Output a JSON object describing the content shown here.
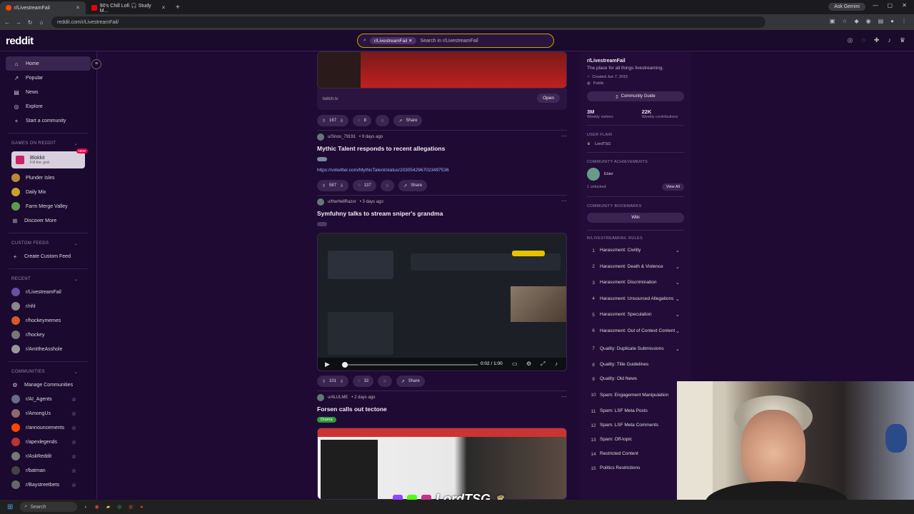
{
  "browser": {
    "tabs": [
      {
        "label": "r/LivestreamFail",
        "active": true
      },
      {
        "label": "90's Chill Lofi 🎧 Study M...",
        "active": false
      }
    ],
    "url": "reddit.com/r/LivestreamFail/",
    "gemini_label": "Ask Gemini"
  },
  "header": {
    "logo": "reddit",
    "search_chip": "r/LivestreamFail",
    "search_placeholder": "Search in r/LivestreamFail"
  },
  "sidebar": {
    "nav": [
      {
        "label": "Home",
        "icon": "home-icon"
      },
      {
        "label": "Popular",
        "icon": "popular-icon"
      },
      {
        "label": "News",
        "icon": "news-icon"
      },
      {
        "label": "Explore",
        "icon": "explore-icon"
      },
      {
        "label": "Start a community",
        "icon": "plus-icon"
      }
    ],
    "games_heading": "GAMES ON REDDIT",
    "blokkit": {
      "label": "Blokkit",
      "sub": "Fill the grid",
      "badge": "NEW"
    },
    "games": [
      "Plunder Isles",
      "Daily Mix",
      "Farm Merge Valley",
      "Discover More"
    ],
    "custom_heading": "CUSTOM FEEDS",
    "create_feed": "Create Custom Feed",
    "recent_heading": "RECENT",
    "recent": [
      "r/LivestreamFail",
      "r/nhl",
      "r/hockeymemes",
      "r/hockey",
      "r/AmItheAsshole"
    ],
    "communities_heading": "COMMUNITIES",
    "manage": "Manage Communities",
    "communities": [
      "r/AI_Agents",
      "r/AmongUs",
      "r/announcements",
      "r/apexlegends",
      "r/AskReddit",
      "r/batman",
      "r/Baystreetbets"
    ]
  },
  "feed": {
    "post0": {
      "source": "twitch.tv",
      "open": "Open",
      "votes": "167",
      "comments": "8",
      "share": "Share"
    },
    "post1": {
      "author": "u/Snoo_79191",
      "time": "• 9 days ago",
      "title": "Mythic Talent responds to recent allegations",
      "link": "https://vxtwitter.com/MythicTalent/status/2030542967023497536",
      "votes": "587",
      "comments": "137",
      "share": "Share"
    },
    "post2": {
      "author": "u/theHellRazor",
      "time": "• 3 days ago",
      "title": "Symfuhny talks to stream sniper's grandma",
      "video_time": "0:02 / 1:00",
      "votes": "101",
      "comments": "32",
      "share": "Share"
    },
    "post3": {
      "author": "u/4LULME",
      "time": "• 2 days ago",
      "title": "Forsen calls out tectone",
      "flair": "Drama"
    }
  },
  "rightbar": {
    "name": "r/LivestreamFail",
    "desc": "The place for all things livestreaming.",
    "created": "Created Jun 7, 2015",
    "visibility": "Public",
    "guide": "Community Guide",
    "visitors_value": "3M",
    "visitors_label": "Weekly visitors",
    "contrib_value": "22K",
    "contrib_label": "Weekly contributions",
    "user_flair_heading": "USER FLAIR",
    "user_flair": "LordTSG",
    "achievements_heading": "COMMUNITY ACHIEVEMENTS",
    "achievement": "Elder",
    "unlocked": "1 unlocked",
    "view_all": "View All",
    "bookmarks_heading": "COMMUNITY BOOKMARKS",
    "wiki": "Wiki",
    "rules_heading": "R/LIVESTREAMFAIL RULES",
    "rules": [
      {
        "n": "1",
        "t": "Harassment: Civility"
      },
      {
        "n": "2",
        "t": "Harassment: Death & Violence"
      },
      {
        "n": "3",
        "t": "Harassment: Discrimination"
      },
      {
        "n": "4",
        "t": "Harassment: Unsourced Allegations"
      },
      {
        "n": "5",
        "t": "Harassment: Speculation"
      },
      {
        "n": "6",
        "t": "Harassment: Out of Context Content"
      },
      {
        "n": "7",
        "t": "Quality: Duplicate Submissions"
      },
      {
        "n": "8",
        "t": "Quality: Title Guidelines"
      },
      {
        "n": "9",
        "t": "Quality: Old News"
      },
      {
        "n": "10",
        "t": "Spam: Engagement Manipulation"
      },
      {
        "n": "11",
        "t": "Spam: LSF Meta Posts"
      },
      {
        "n": "12",
        "t": "Spam: LSF Meta Comments"
      },
      {
        "n": "13",
        "t": "Spam: Off-topic"
      },
      {
        "n": "14",
        "t": "Restricted Content"
      },
      {
        "n": "15",
        "t": "Politics Restrictions"
      }
    ]
  },
  "overlay": {
    "brand": "LordTSG"
  },
  "taskbar": {
    "search": "Search"
  }
}
